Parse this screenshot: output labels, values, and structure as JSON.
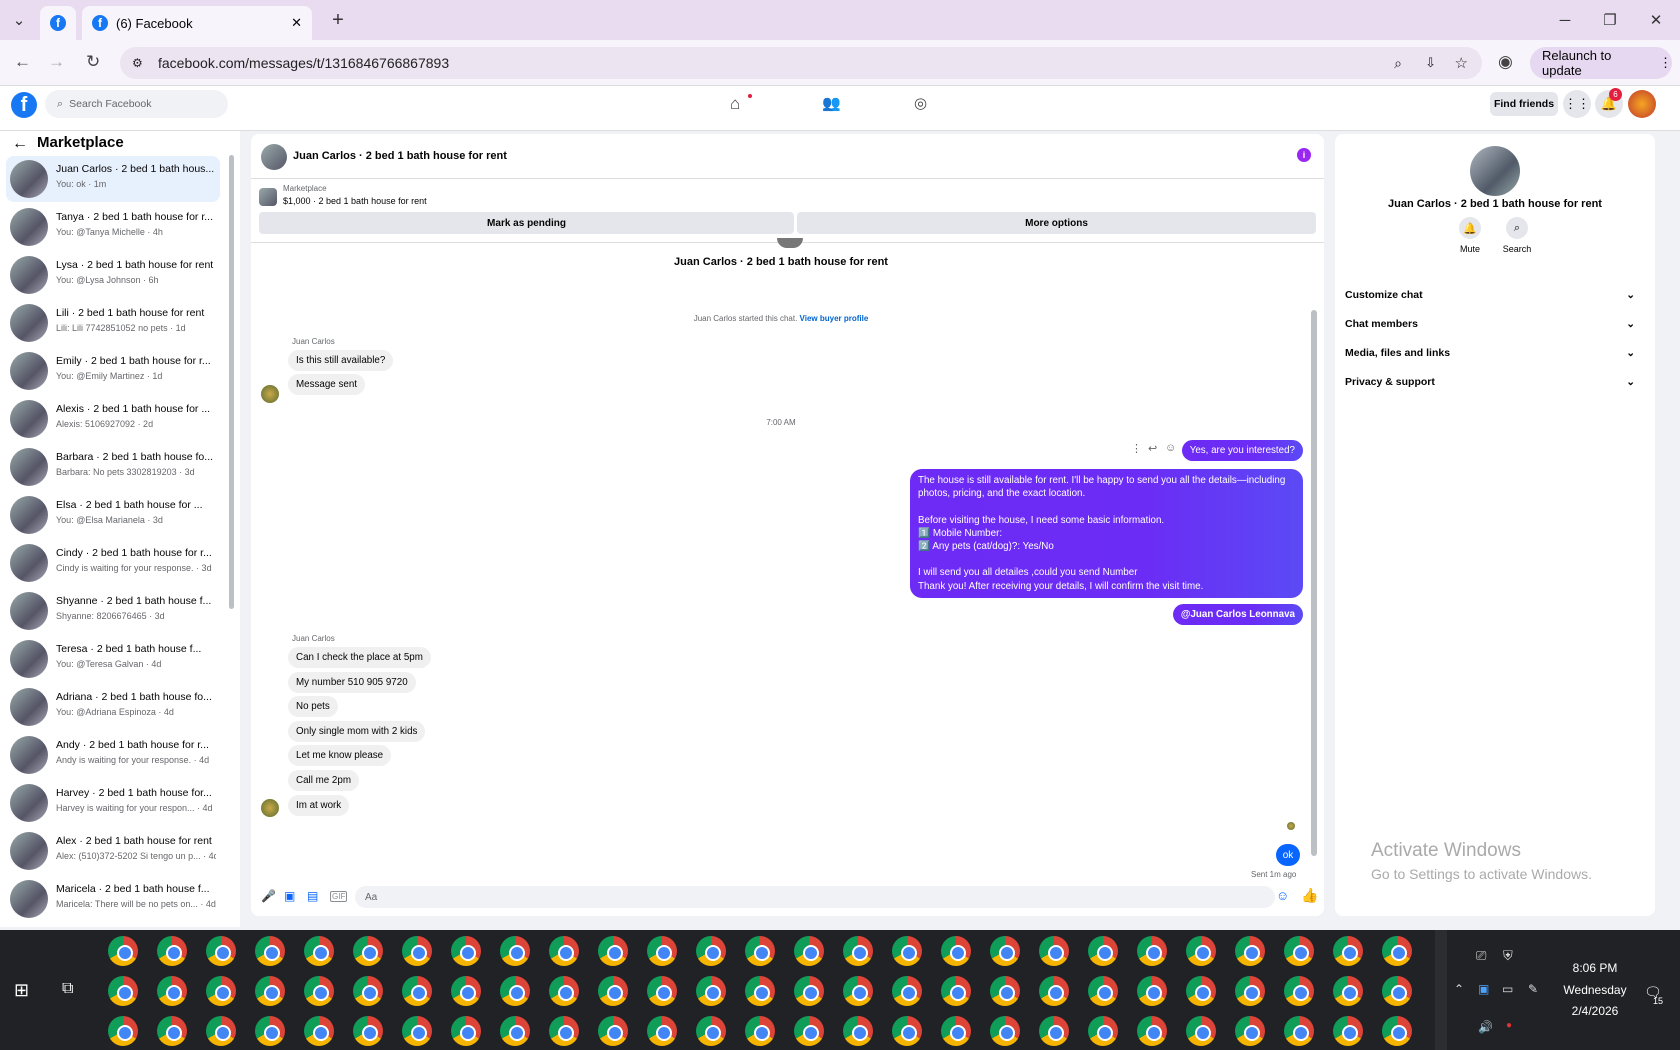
{
  "browser": {
    "tab_label": "(6) Facebook",
    "url": "facebook.com/messages/t/1316846766867893",
    "relaunch": "Relaunch to update"
  },
  "fb": {
    "search_placeholder": "Search Facebook",
    "find_friends": "Find friends",
    "notif_badge": "6"
  },
  "sidebar": {
    "title": "Marketplace",
    "conversations": [
      {
        "name": "Juan Carlos · 2 bed 1 bath hous...",
        "sub": "You: ok · 1m"
      },
      {
        "name": "Tanya · 2 bed 1 bath house for r...",
        "sub": "You: @Tanya Michelle · 4h"
      },
      {
        "name": "Lysa · 2 bed 1 bath house for rent",
        "sub": "You: @Lysa Johnson · 6h"
      },
      {
        "name": "Lili · 2 bed 1 bath house for rent",
        "sub": "Lili: Lili 7742851052 no pets · 1d"
      },
      {
        "name": "Emily · 2 bed 1 bath house for r...",
        "sub": "You: @Emily Martinez · 1d"
      },
      {
        "name": "Alexis · 2 bed 1 bath house for ...",
        "sub": "Alexis: 5106927092 · 2d"
      },
      {
        "name": "Barbara · 2 bed 1 bath house fo...",
        "sub": "Barbara: No pets 3302819203 · 3d"
      },
      {
        "name": "Elsa · 2 bed 1 bath house for ...",
        "sub": "You: @Elsa Marianela · 3d"
      },
      {
        "name": "Cindy · 2 bed 1 bath house for r...",
        "sub": "Cindy is waiting for your response. · 3d"
      },
      {
        "name": "Shyanne · 2 bed 1 bath house f...",
        "sub": "Shyanne: 8206676465 · 3d"
      },
      {
        "name": "Teresa · 2 bed 1 bath house f...",
        "sub": "You: @Teresa Galvan · 4d"
      },
      {
        "name": "Adriana · 2 bed 1 bath house fo...",
        "sub": "You: @Adriana Espinoza · 4d"
      },
      {
        "name": "Andy · 2 bed 1 bath house for r...",
        "sub": "Andy is waiting for your response. · 4d"
      },
      {
        "name": "Harvey · 2 bed 1 bath house for...",
        "sub": "Harvey is waiting for your respon... · 4d"
      },
      {
        "name": "Alex · 2 bed 1 bath house for rent",
        "sub": "Alex: (510)372-5202 Si tengo un p... · 4d"
      },
      {
        "name": "Maricela · 2 bed 1 bath house f...",
        "sub": "Maricela: There will be no pets on... · 4d"
      }
    ]
  },
  "chat": {
    "header": "Juan Carlos · 2 bed 1 bath house for rent",
    "listing_label": "Marketplace",
    "listing": "$1,000 · 2 bed 1 bath house for rent",
    "mark_pending": "Mark as pending",
    "more_options": "More options",
    "center_title": "Juan Carlos · 2 bed 1 bath house for rent",
    "started": "Juan Carlos started this chat.",
    "view_buyer": "View buyer profile",
    "sender": "Juan Carlos",
    "msg1": "Is this still available?",
    "msg2": "Message sent",
    "time": "7:00 AM",
    "my1": "Yes, are you interested?",
    "my2": [
      "The house is still available for rent. I'll be happy to send you all the details—including",
      "photos, pricing, and the exact location.",
      "",
      "Before visiting the house, I need some basic information.",
      "1️⃣ Mobile Number:",
      "2️⃣ Any pets (cat/dog)?: Yes/No",
      "",
      "I will send you all detailes ,could you send Number",
      "Thank you! After receiving your details, I will confirm the visit time."
    ],
    "my3": "@Juan Carlos Leonnava",
    "replies": [
      "Can I check the place at 5pm",
      "My number 510 905 9720",
      "No pets",
      "Only single mom with 2 kids",
      "Let me know please",
      "Call me 2pm",
      "Im at work"
    ],
    "ok": "ok",
    "sent": "Sent 1m ago",
    "input_placeholder": "Aa"
  },
  "rpanel": {
    "name": "Juan Carlos · 2 bed 1 bath house for rent",
    "mute": "Mute",
    "search": "Search",
    "items": [
      "Customize chat",
      "Chat members",
      "Media, files and links",
      "Privacy & support"
    ],
    "activate1": "Activate Windows",
    "activate2": "Go to Settings to activate Windows."
  },
  "taskbar": {
    "time": "8:06 PM",
    "day": "Wednesday",
    "date": "2/4/2026",
    "notif": "15"
  }
}
